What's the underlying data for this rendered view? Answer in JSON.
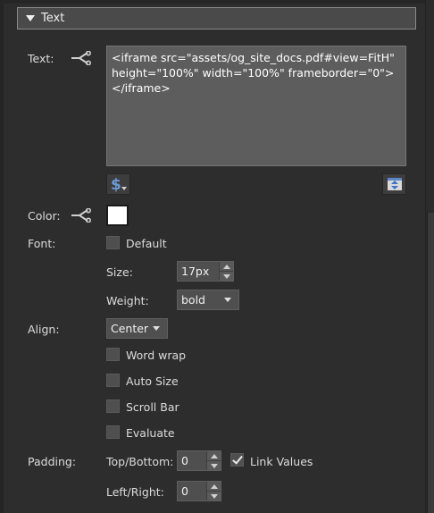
{
  "section": {
    "title": "Text"
  },
  "text_field": {
    "label": "Text:",
    "value": "<iframe src=\"assets/og_site_docs.pdf#view=FitH\" height=\"100%\" width=\"100%\" frameborder=\"0\"></iframe>"
  },
  "icons": {
    "link": "link-icon",
    "variable": "dollar-variable-icon",
    "expand": "expand-editor-icon"
  },
  "color": {
    "label": "Color:",
    "value": "#ffffff"
  },
  "font": {
    "label": "Font:",
    "default_label": "Default",
    "default_checked": false,
    "size_label": "Size:",
    "size_value": "17px",
    "weight_label": "Weight:",
    "weight_value": "bold"
  },
  "align": {
    "label": "Align:",
    "value": "Center",
    "word_wrap_label": "Word wrap",
    "auto_size_label": "Auto Size",
    "scroll_bar_label": "Scroll Bar",
    "evaluate_label": "Evaluate"
  },
  "padding": {
    "label": "Padding:",
    "top_bottom_label": "Top/Bottom:",
    "top_bottom_value": "0",
    "left_right_label": "Left/Right:",
    "left_right_value": "0",
    "link_values_label": "Link Values",
    "link_values_checked": true
  }
}
